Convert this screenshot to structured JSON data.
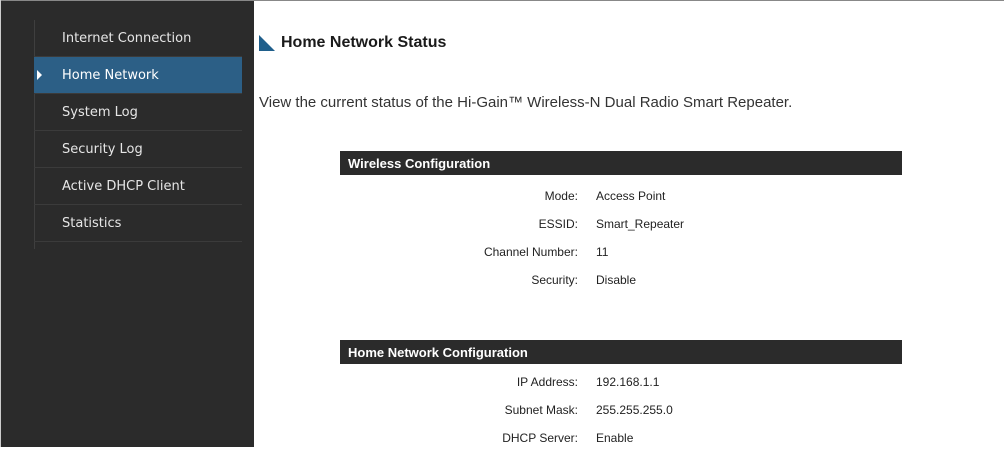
{
  "sidebar": {
    "items": [
      {
        "label": "Internet Connection",
        "active": false
      },
      {
        "label": "Home Network",
        "active": true
      },
      {
        "label": "System Log",
        "active": false
      },
      {
        "label": "Security Log",
        "active": false
      },
      {
        "label": "Active DHCP Client",
        "active": false
      },
      {
        "label": "Statistics",
        "active": false
      }
    ]
  },
  "main": {
    "title": "Home Network Status",
    "intro": "View the current status of the Hi-Gain™ Wireless-N Dual Radio Smart Repeater.",
    "wireless": {
      "header": "Wireless Configuration",
      "rows": [
        {
          "label": "Mode:",
          "value": "Access Point"
        },
        {
          "label": "ESSID:",
          "value": "Smart_Repeater"
        },
        {
          "label": "Channel Number:",
          "value": "11"
        },
        {
          "label": "Security:",
          "value": "Disable"
        }
      ]
    },
    "home_network": {
      "header": "Home Network Configuration",
      "rows": [
        {
          "label": "IP Address:",
          "value": "192.168.1.1"
        },
        {
          "label": "Subnet Mask:",
          "value": "255.255.255.0"
        },
        {
          "label": "DHCP Server:",
          "value": "Enable"
        }
      ]
    }
  },
  "colors": {
    "sidebar_bg": "#2b2b2b",
    "active_item": "#2c5f86",
    "section_header": "#2b2b2b",
    "title_icon": "#1f5f8b"
  }
}
